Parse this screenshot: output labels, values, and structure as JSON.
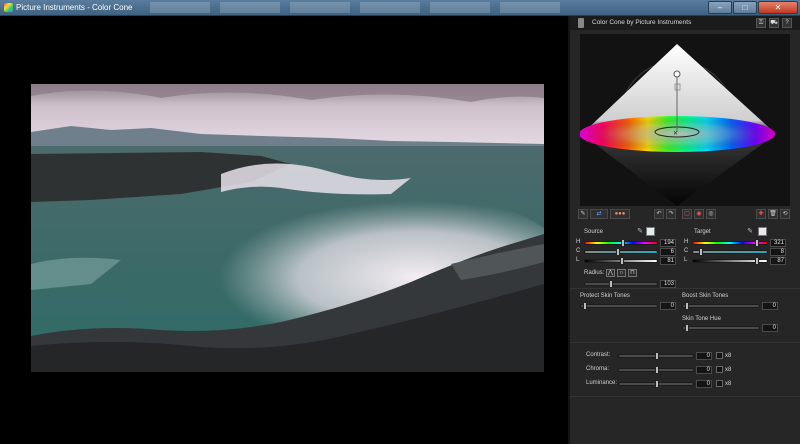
{
  "window": {
    "title": "Picture Instruments - Color Cone",
    "controls": [
      "–",
      "□",
      "✕"
    ]
  },
  "panel": {
    "title": "Color Cone by Picture Instruments",
    "header_buttons": [
      "key-icon",
      "cart-icon",
      "?"
    ]
  },
  "toolbar": {
    "buttons": [
      "eyedropper-icon",
      "swap-colors-icon",
      "color-triplet-icon",
      "undo-icon",
      "redo-icon",
      "reset-view-icon",
      "record-icon",
      "eye-icon",
      "add-point-icon",
      "trash-icon",
      "refresh-icon"
    ],
    "undo": "↶",
    "redo": "↷",
    "trash": "🗑",
    "refresh": "⟲"
  },
  "source": {
    "label": "Source",
    "swatch_color": "#e4ecef",
    "rows": [
      {
        "label": "H",
        "value": "194",
        "level": 0.54
      },
      {
        "label": "C",
        "value": "6",
        "level": 0.46
      },
      {
        "label": "L",
        "value": "81",
        "level": 0.52
      }
    ]
  },
  "target": {
    "label": "Target",
    "swatch_color": "#efe7ef",
    "rows": [
      {
        "label": "H",
        "value": "321",
        "level": 0.9
      },
      {
        "label": "C",
        "value": "8",
        "level": 0.08
      },
      {
        "label": "L",
        "value": "87",
        "level": 0.9
      }
    ]
  },
  "radius": {
    "label": "Radius:",
    "value": "103",
    "level": 0.36
  },
  "skin": {
    "protect_label": "Protect Skin Tones",
    "protect_value": "0",
    "boost_label": "Boost Skin Tones",
    "boost_value": "0",
    "hue_label": "Skin Tone Hue",
    "hue_value": "0"
  },
  "adjust": [
    {
      "label": "Contrast:",
      "value": "0",
      "x": "x8"
    },
    {
      "label": "Chroma:",
      "value": "0",
      "x": "x8"
    },
    {
      "label": "Luminance:",
      "value": "0",
      "x": "x8"
    }
  ],
  "colors": {
    "accent": "#4d7aa3",
    "panel_bg": "#262626",
    "close_red": "#c2381f"
  }
}
